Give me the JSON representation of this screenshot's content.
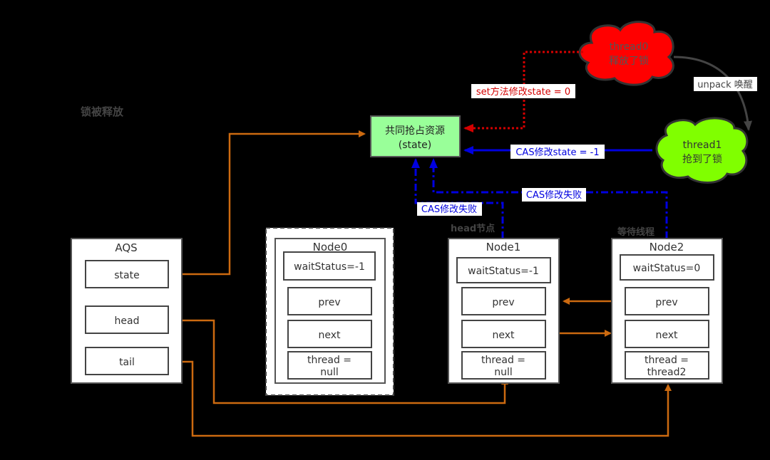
{
  "title": "锁被释放",
  "resource": {
    "line1": "共同抢占资源",
    "line2": "(state)"
  },
  "threads": {
    "thread0": {
      "line1": "thread0",
      "line2": "释放了锁",
      "color": "#ff0000"
    },
    "thread1": {
      "line1": "thread1",
      "line2": "抢到了锁",
      "color": "#80ff00"
    }
  },
  "edge_labels": {
    "set_state": "set方法修改state = 0",
    "unpack": "unpack 唤醒",
    "cas_state": "CAS修改state = -1",
    "cas_fail_1": "CAS修改失败",
    "cas_fail_2": "CAS修改失败"
  },
  "annotations": {
    "head_node": "head节点",
    "waiting_thread": "等待线程"
  },
  "aqs": {
    "title": "AQS",
    "fields": [
      "state",
      "head",
      "tail"
    ]
  },
  "nodes": [
    {
      "title": "Node0",
      "waitStatus": "waitStatus=-1",
      "prev": "prev",
      "next": "next",
      "thread1": "thread =",
      "thread2": "null"
    },
    {
      "title": "Node1",
      "waitStatus": "waitStatus=-1",
      "prev": "prev",
      "next": "next",
      "thread1": "thread =",
      "thread2": "null"
    },
    {
      "title": "Node2",
      "waitStatus": "waitStatus=0",
      "prev": "prev",
      "next": "next",
      "thread1": "thread =",
      "thread2": "thread2"
    }
  ],
  "colors": {
    "orange": "#cc6a10",
    "blue": "#0000e0",
    "red": "#d40000",
    "resource": "#99ff99"
  }
}
